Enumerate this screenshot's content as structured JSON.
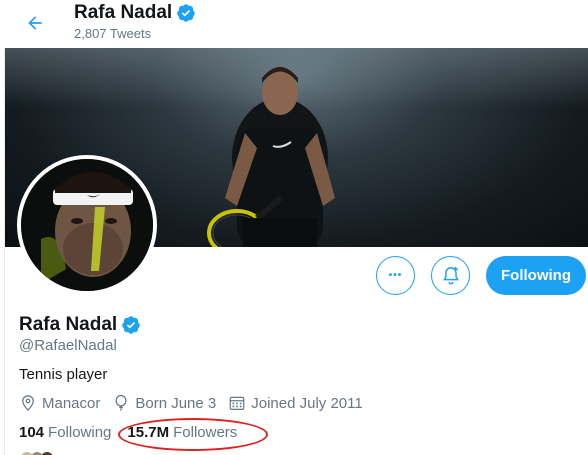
{
  "header": {
    "name": "Rafa Nadal",
    "tweets": "2,807 Tweets"
  },
  "profile": {
    "name": "Rafa Nadal",
    "handle": "@RafaelNadal",
    "bio": "Tennis player",
    "location": "Manacor",
    "birthday": "Born June 3",
    "joined": "Joined July 2011"
  },
  "actions": {
    "more_label": "•••",
    "following_label": "Following"
  },
  "stats": {
    "following_count": "104",
    "following_label": "Following",
    "followers_count": "15.7M",
    "followers_label": "Followers"
  },
  "colors": {
    "accent": "#1da1f2",
    "annotation": "#e02020"
  }
}
